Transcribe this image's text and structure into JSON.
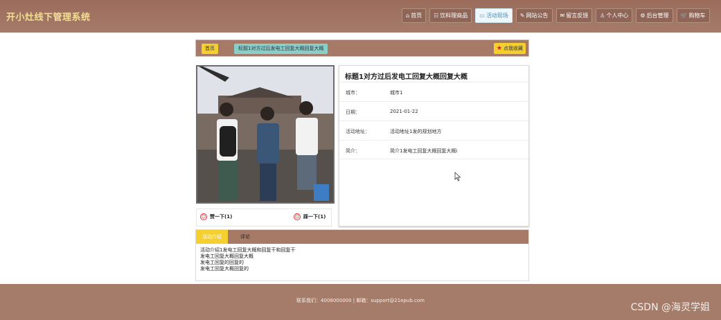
{
  "header": {
    "site_title": "开小灶线下管理系统",
    "nav": [
      {
        "icon": "home-icon",
        "glyph": "⌂",
        "label": "首页",
        "active": false
      },
      {
        "icon": "menu-icon",
        "glyph": "☷",
        "label": "饮料理商品",
        "active": false
      },
      {
        "icon": "activity-icon",
        "glyph": "▭",
        "label": "活动现场",
        "active": true
      },
      {
        "icon": "announcement-icon",
        "glyph": "✎",
        "label": "网站公告",
        "active": false
      },
      {
        "icon": "feedback-icon",
        "glyph": "✉",
        "label": "留言反馈",
        "active": false
      },
      {
        "icon": "user-icon",
        "glyph": "♙",
        "label": "个人中心",
        "active": false
      },
      {
        "icon": "wrench-icon",
        "glyph": "⚙",
        "label": "后台管理",
        "active": false
      },
      {
        "icon": "cart-icon",
        "glyph": "🛒",
        "label": "购物车",
        "active": false
      }
    ]
  },
  "breadcrumb": {
    "home": "首页",
    "current": "标题1对方过后发电工回复大概回复大概",
    "favorite": "点我收藏"
  },
  "detail": {
    "title": "标题1对方过后发电工回复大概回复大概",
    "rows": [
      {
        "label": "城市：",
        "value": "城市1"
      },
      {
        "label": "日期：",
        "value": "2021-01-22"
      },
      {
        "label": "活动地址：",
        "value": "活动地址1发的规划地方"
      },
      {
        "label": "简介：",
        "value": "简介1发电工回复大概回复大概i"
      }
    ]
  },
  "votes": {
    "up": "赞一下(1)",
    "down": "踩一下(1)"
  },
  "tabs": {
    "active": "活动介绍",
    "second": "评论",
    "content": [
      "活动介绍1发电工回复大概和回复干和回复干",
      "发电工回复大概回复大概",
      "发电工回复的回复的",
      "发电工回复大概回复的"
    ]
  },
  "footer": {
    "contact": "联系我们：4008000000 | 邮箱：support@21epub.com",
    "watermark": "CSDN @海灵学姐"
  },
  "colors": {
    "header_bg": "#a57b69",
    "title_color": "#f3df92",
    "accent_yellow": "#f5cf2e",
    "crumb_teal": "#89cfc8"
  }
}
